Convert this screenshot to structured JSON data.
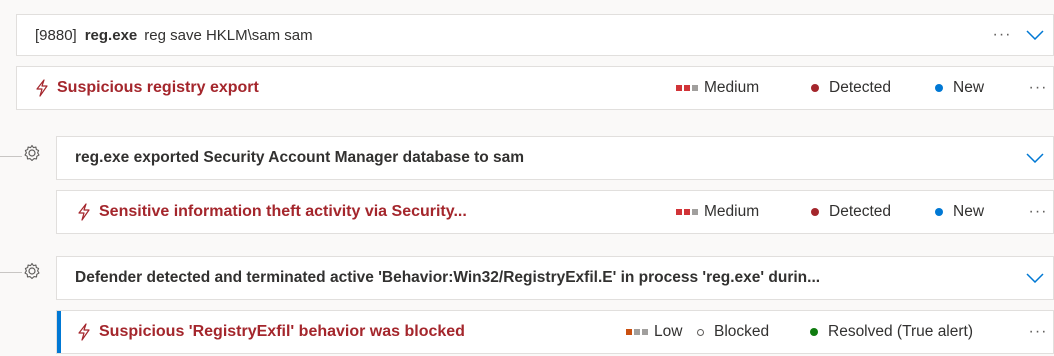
{
  "process": {
    "pid": "[9880]",
    "name": "reg.exe",
    "command": "reg save HKLM\\sam sam",
    "more": "···"
  },
  "alerts": [
    {
      "title": "Suspicious registry export",
      "severity": "Medium",
      "severity_colors": [
        "#d13438",
        "#d13438",
        "#a19f9d"
      ],
      "detection": "Detected",
      "detection_color": "#a4262c",
      "status": "New",
      "status_color": "#0078d4",
      "more": "···"
    },
    {
      "title": "Sensitive information theft activity via Security...",
      "severity": "Medium",
      "severity_colors": [
        "#d13438",
        "#d13438",
        "#a19f9d"
      ],
      "detection": "Detected",
      "detection_color": "#a4262c",
      "status": "New",
      "status_color": "#0078d4",
      "more": "···"
    },
    {
      "title": "Suspicious 'RegistryExfil' behavior was blocked",
      "severity": "Low",
      "severity_colors": [
        "#ca5010",
        "#a19f9d",
        "#a19f9d"
      ],
      "detection": "Blocked",
      "status": "Resolved (True alert)",
      "status_color": "#107c10",
      "more": "···"
    }
  ],
  "events": [
    {
      "text": "reg.exe exported Security Account Manager database to sam"
    },
    {
      "text": "Defender detected and terminated active 'Behavior:Win32/RegistryExfil.E' in process 'reg.exe' durin..."
    }
  ],
  "colors": {
    "alert_title": "#a4262c",
    "accent": "#0078d4",
    "chevron": "#0078d4"
  }
}
